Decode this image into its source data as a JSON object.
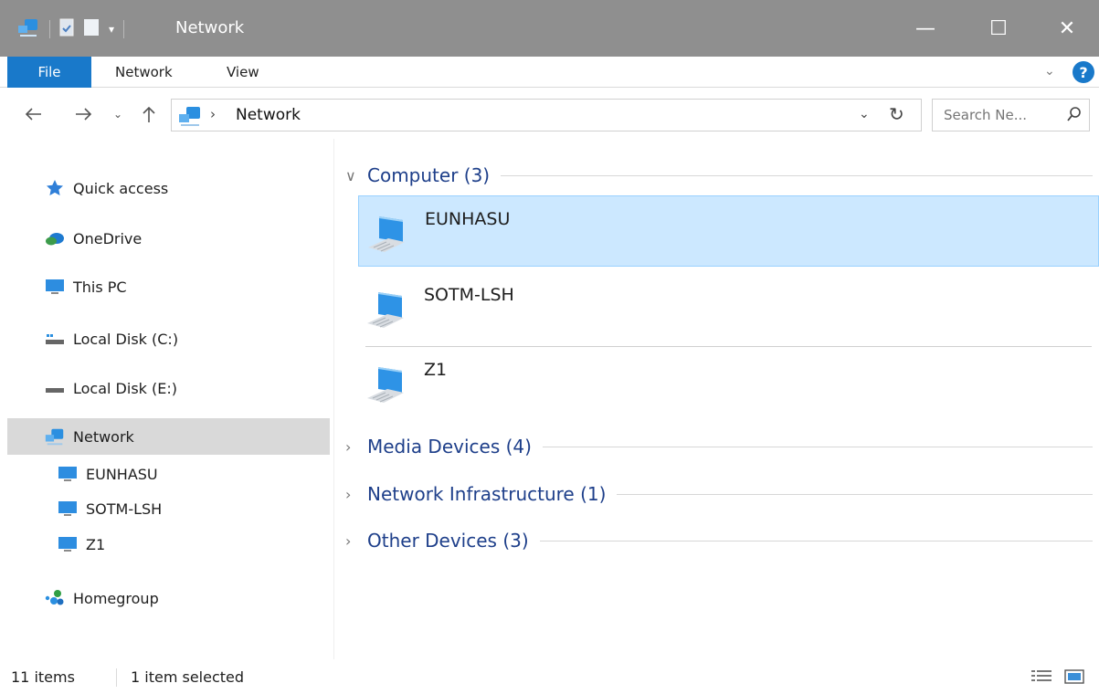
{
  "window": {
    "title": "Network",
    "controls": {
      "minimize": "—",
      "maximize": "☐",
      "close": "✕"
    }
  },
  "ribbon": {
    "tabs": [
      {
        "label": "File"
      },
      {
        "label": "Network"
      },
      {
        "label": "View"
      }
    ]
  },
  "address": {
    "crumb": "Network",
    "search_placeholder": "Search Ne..."
  },
  "nav": {
    "items": [
      {
        "label": "Quick access",
        "icon": "star-icon"
      },
      {
        "label": "OneDrive",
        "icon": "onedrive-icon"
      },
      {
        "label": "This PC",
        "icon": "monitor-icon"
      },
      {
        "label": "Local Disk (C:)",
        "icon": "drive-icon"
      },
      {
        "label": "Local Disk (E:)",
        "icon": "drive-icon"
      },
      {
        "label": "Network",
        "icon": "network-icon",
        "selected": true
      },
      {
        "label": "EUNHASU",
        "icon": "monitor-icon"
      },
      {
        "label": "SOTM-LSH",
        "icon": "monitor-icon"
      },
      {
        "label": "Z1",
        "icon": "monitor-icon"
      },
      {
        "label": "Homegroup",
        "icon": "homegroup-icon"
      }
    ]
  },
  "content": {
    "groups": [
      {
        "label": "Computer (3)",
        "expanded": true
      },
      {
        "label": "Media Devices (4)",
        "expanded": false
      },
      {
        "label": "Network Infrastructure (1)",
        "expanded": false
      },
      {
        "label": "Other Devices (3)",
        "expanded": false
      }
    ],
    "computers": [
      {
        "name": "EUNHASU",
        "selected": true
      },
      {
        "name": "SOTM-LSH"
      },
      {
        "name": "Z1"
      }
    ]
  },
  "status": {
    "item_count": "11 items",
    "selection": "1 item selected"
  },
  "colors": {
    "accent": "#1979ca",
    "selection_bg": "#cce8ff",
    "group_label": "#1e3f8a",
    "titlebar": "#8f8f8f"
  }
}
